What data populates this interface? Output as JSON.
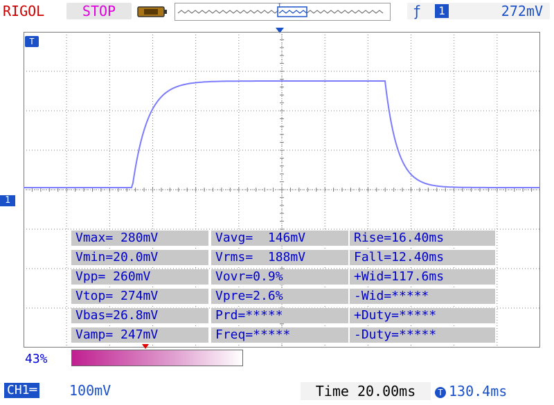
{
  "header": {
    "brand": "RIGOL",
    "run_state": "STOP",
    "trigger": {
      "edge_icon": "rising-edge-icon",
      "edge_glyph": "ƒ",
      "channel": "1",
      "level": "272mV"
    },
    "timebar_marker": "T"
  },
  "screen": {
    "trigger_pos_marker": "T",
    "channel_marker": "1",
    "waveform_color": "#7b7bff",
    "grid_color": "#7a7a7a"
  },
  "measurements": [
    [
      "Vmax= 280mV",
      "Vavg=  146mV",
      "Rise=16.40ms"
    ],
    [
      "Vmin=20.0mV",
      "Vrms=  188mV",
      "Fall=12.40ms"
    ],
    [
      "Vpp= 260mV",
      "Vovr=0.9%",
      "+Wid=117.6ms"
    ],
    [
      "Vtop= 274mV",
      "Vpre=2.6%",
      "-Wid=*****"
    ],
    [
      "Vbas=26.8mV",
      "Prd=*****",
      "+Duty=*****"
    ],
    [
      "Vamp= 247mV",
      "Freq=*****",
      "-Duty=*****"
    ]
  ],
  "memory": {
    "percent": "43%",
    "fill_fraction": 0.43
  },
  "footer": {
    "ch1_label": "CH1",
    "vscale": "100mV",
    "time_label": "Time 20.00ms",
    "pos_icon": "T",
    "position": "130.4ms"
  }
}
